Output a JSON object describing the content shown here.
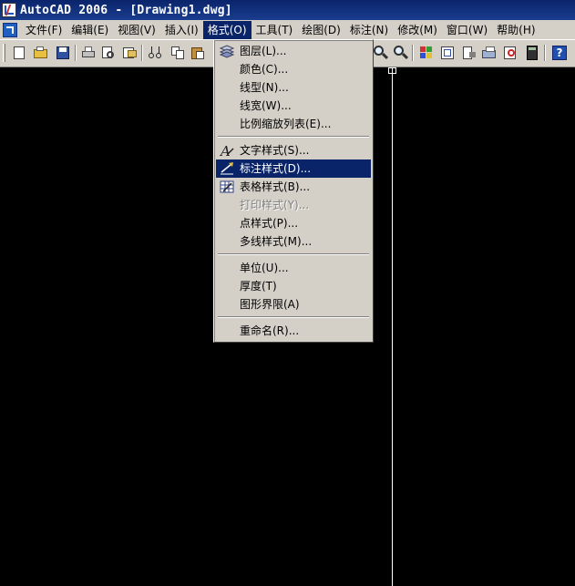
{
  "window": {
    "title": "AutoCAD 2006 - [Drawing1.dwg]"
  },
  "menubar": {
    "items": [
      {
        "label": "文件(F)"
      },
      {
        "label": "编辑(E)"
      },
      {
        "label": "视图(V)"
      },
      {
        "label": "插入(I)"
      },
      {
        "label": "格式(O)",
        "active": true
      },
      {
        "label": "工具(T)"
      },
      {
        "label": "绘图(D)"
      },
      {
        "label": "标注(N)"
      },
      {
        "label": "修改(M)"
      },
      {
        "label": "窗口(W)"
      },
      {
        "label": "帮助(H)"
      }
    ]
  },
  "toolbar": {
    "buttons": [
      "new-icon",
      "open-icon",
      "save-icon",
      "print-icon",
      "plot-preview-icon",
      "publish-icon",
      "cut-icon",
      "copy-icon",
      "paste-icon",
      "zoom-window-icon",
      "zoom-previous-icon",
      "properties-icon",
      "design-center-icon",
      "tool-palettes-icon",
      "sheet-set-icon",
      "markup-icon",
      "calculator-icon",
      "help-icon"
    ]
  },
  "format_menu": {
    "groups": [
      [
        {
          "label": "图层(L)...",
          "icon": "layers-icon"
        },
        {
          "label": "颜色(C)..."
        },
        {
          "label": "线型(N)..."
        },
        {
          "label": "线宽(W)..."
        },
        {
          "label": "比例缩放列表(E)..."
        }
      ],
      [
        {
          "label": "文字样式(S)...",
          "icon": "text-style-icon"
        },
        {
          "label": "标注样式(D)...",
          "icon": "dimension-style-icon",
          "highlighted": true
        },
        {
          "label": "表格样式(B)...",
          "icon": "table-style-icon"
        },
        {
          "label": "打印样式(Y)...",
          "disabled": true
        },
        {
          "label": "点样式(P)..."
        },
        {
          "label": "多线样式(M)..."
        }
      ],
      [
        {
          "label": "单位(U)..."
        },
        {
          "label": "厚度(T)"
        },
        {
          "label": "图形界限(A)"
        }
      ],
      [
        {
          "label": "重命名(R)..."
        }
      ]
    ]
  },
  "colors": {
    "titlebar": "#0a246a",
    "highlight": "#0a246a",
    "face": "#d4d0c8",
    "canvas": "#000000"
  }
}
